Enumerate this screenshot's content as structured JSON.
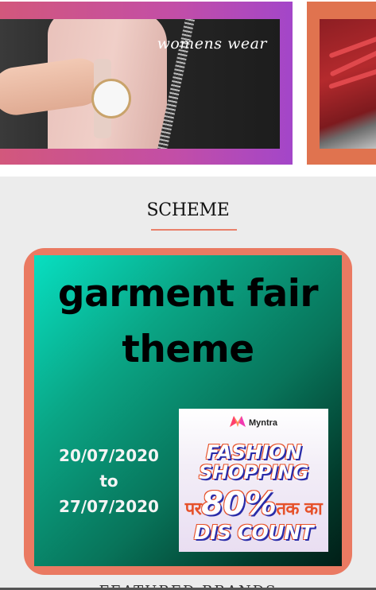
{
  "carousel": {
    "cards": [
      {
        "label": "womens wear"
      },
      {
        "label": ""
      }
    ]
  },
  "section": {
    "title": "SCHEME"
  },
  "poster": {
    "title_line1": "garment fair",
    "title_line2": "theme",
    "date_start": "20/07/2020",
    "date_sep": "to",
    "date_end": "27/07/2020",
    "promo": {
      "brand": "Myntra",
      "line1": "FASHION",
      "line2": "SHOPPING",
      "line3_prefix": "पर",
      "line3_value": "80%",
      "line3_suffix": "तक का",
      "line4": "DIS COUNT"
    }
  },
  "next_section": {
    "title": "FEATURED BRANDS"
  },
  "colors": {
    "accent": "#ea7a62",
    "underline": "#e9806a",
    "poster_bg_start": "#08dfc1",
    "poster_bg_end": "#011e17"
  }
}
